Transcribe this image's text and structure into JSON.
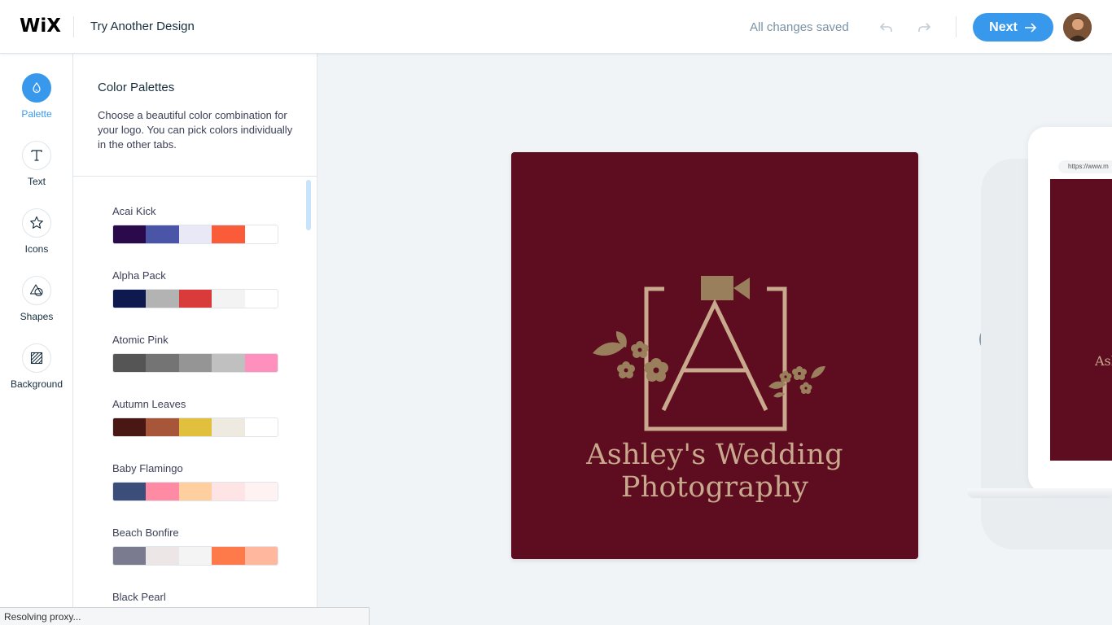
{
  "header": {
    "brand": "WiX",
    "title": "Try Another Design",
    "save_status": "All changes saved",
    "next_label": "Next"
  },
  "rail": {
    "items": [
      {
        "label": "Palette",
        "icon": "palette-drop-icon",
        "active": true
      },
      {
        "label": "Text",
        "icon": "text-t-icon"
      },
      {
        "label": "Icons",
        "icon": "star-icon"
      },
      {
        "label": "Shapes",
        "icon": "shapes-icon"
      },
      {
        "label": "Background",
        "icon": "background-hatch-icon"
      }
    ]
  },
  "panel": {
    "title": "Color Palettes",
    "description": "Choose a beautiful color combination for your logo. You can pick colors individually in the other tabs.",
    "palettes": [
      {
        "name": "Acai Kick",
        "colors": [
          "#2a0a4a",
          "#4a55a8",
          "#e8e8f6",
          "#fa5c3a",
          "#ffffff"
        ]
      },
      {
        "name": "Alpha Pack",
        "colors": [
          "#0e1a4f",
          "#b3b3b3",
          "#d93a3a",
          "#f3f3f3",
          "#ffffff"
        ]
      },
      {
        "name": "Atomic Pink",
        "colors": [
          "#555555",
          "#747474",
          "#959595",
          "#c0c0c0",
          "#ff8fbd"
        ]
      },
      {
        "name": "Autumn Leaves",
        "colors": [
          "#4a1814",
          "#a8563a",
          "#e0c03c",
          "#eeeae0",
          "#ffffff"
        ]
      },
      {
        "name": "Baby Flamingo",
        "colors": [
          "#3b4e7a",
          "#ff8aa3",
          "#ffcfa0",
          "#ffe4e6",
          "#fff2f2"
        ]
      },
      {
        "name": "Beach Bonfire",
        "colors": [
          "#7b7b90",
          "#ece6e6",
          "#f4f4f4",
          "#ff7a4a",
          "#ffb89e"
        ]
      },
      {
        "name": "Black Pearl",
        "colors": [
          "#111111",
          "#444444",
          "#888888",
          "#cccccc",
          "#ffffff"
        ]
      }
    ]
  },
  "canvas": {
    "logo_text": "Ashley's Wedding Photography",
    "logo_bg": "#5e0c1f",
    "logo_fg": "#c9a98d",
    "icon_fg": "#9a7f5c"
  },
  "preview": {
    "url": "https://www.m",
    "screen_text": "Ash"
  },
  "statusbar": {
    "text": "Resolving proxy..."
  },
  "colors": {
    "accent": "#3899ec"
  }
}
